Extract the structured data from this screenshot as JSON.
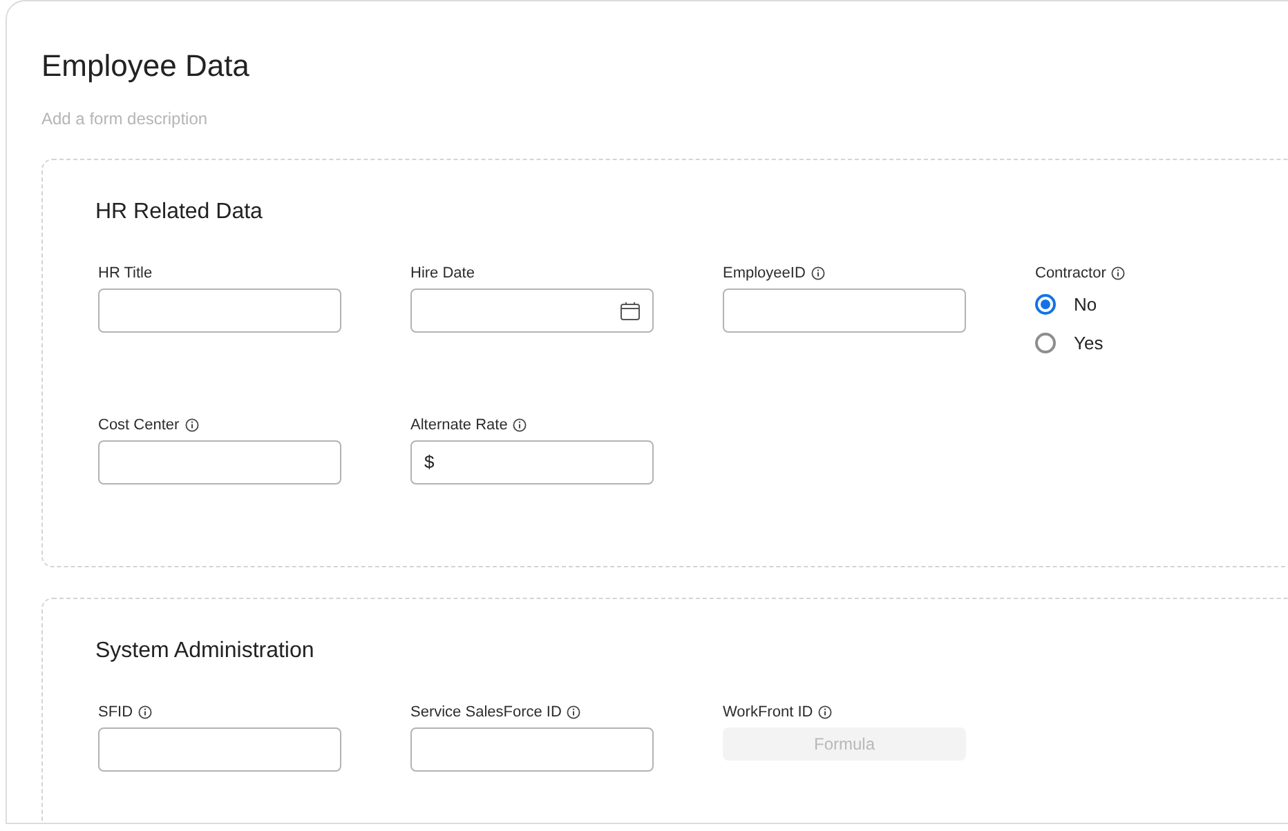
{
  "form": {
    "title": "Employee Data",
    "description_placeholder": "Add a form description"
  },
  "sections": [
    {
      "title": "HR Related Data",
      "rows": [
        [
          {
            "kind": "text",
            "label": "HR Title",
            "info": false
          },
          {
            "kind": "date",
            "label": "Hire Date",
            "info": false
          },
          {
            "kind": "text",
            "label": "EmployeeID",
            "info": true
          },
          {
            "kind": "radio",
            "label": "Contractor",
            "info": true,
            "options": [
              {
                "label": "No",
                "selected": true
              },
              {
                "label": "Yes",
                "selected": false
              }
            ]
          }
        ],
        [
          {
            "kind": "text",
            "label": "Cost Center",
            "info": true
          },
          {
            "kind": "currency",
            "label": "Alternate Rate",
            "info": true,
            "prefix": "$"
          }
        ]
      ]
    },
    {
      "title": "System Administration",
      "rows": [
        [
          {
            "kind": "text",
            "label": "SFID",
            "info": true
          },
          {
            "kind": "text",
            "label": "Service SalesForce ID",
            "info": true
          },
          {
            "kind": "formula",
            "label": "WorkFront ID",
            "info": true,
            "value": "Formula"
          }
        ]
      ]
    }
  ]
}
